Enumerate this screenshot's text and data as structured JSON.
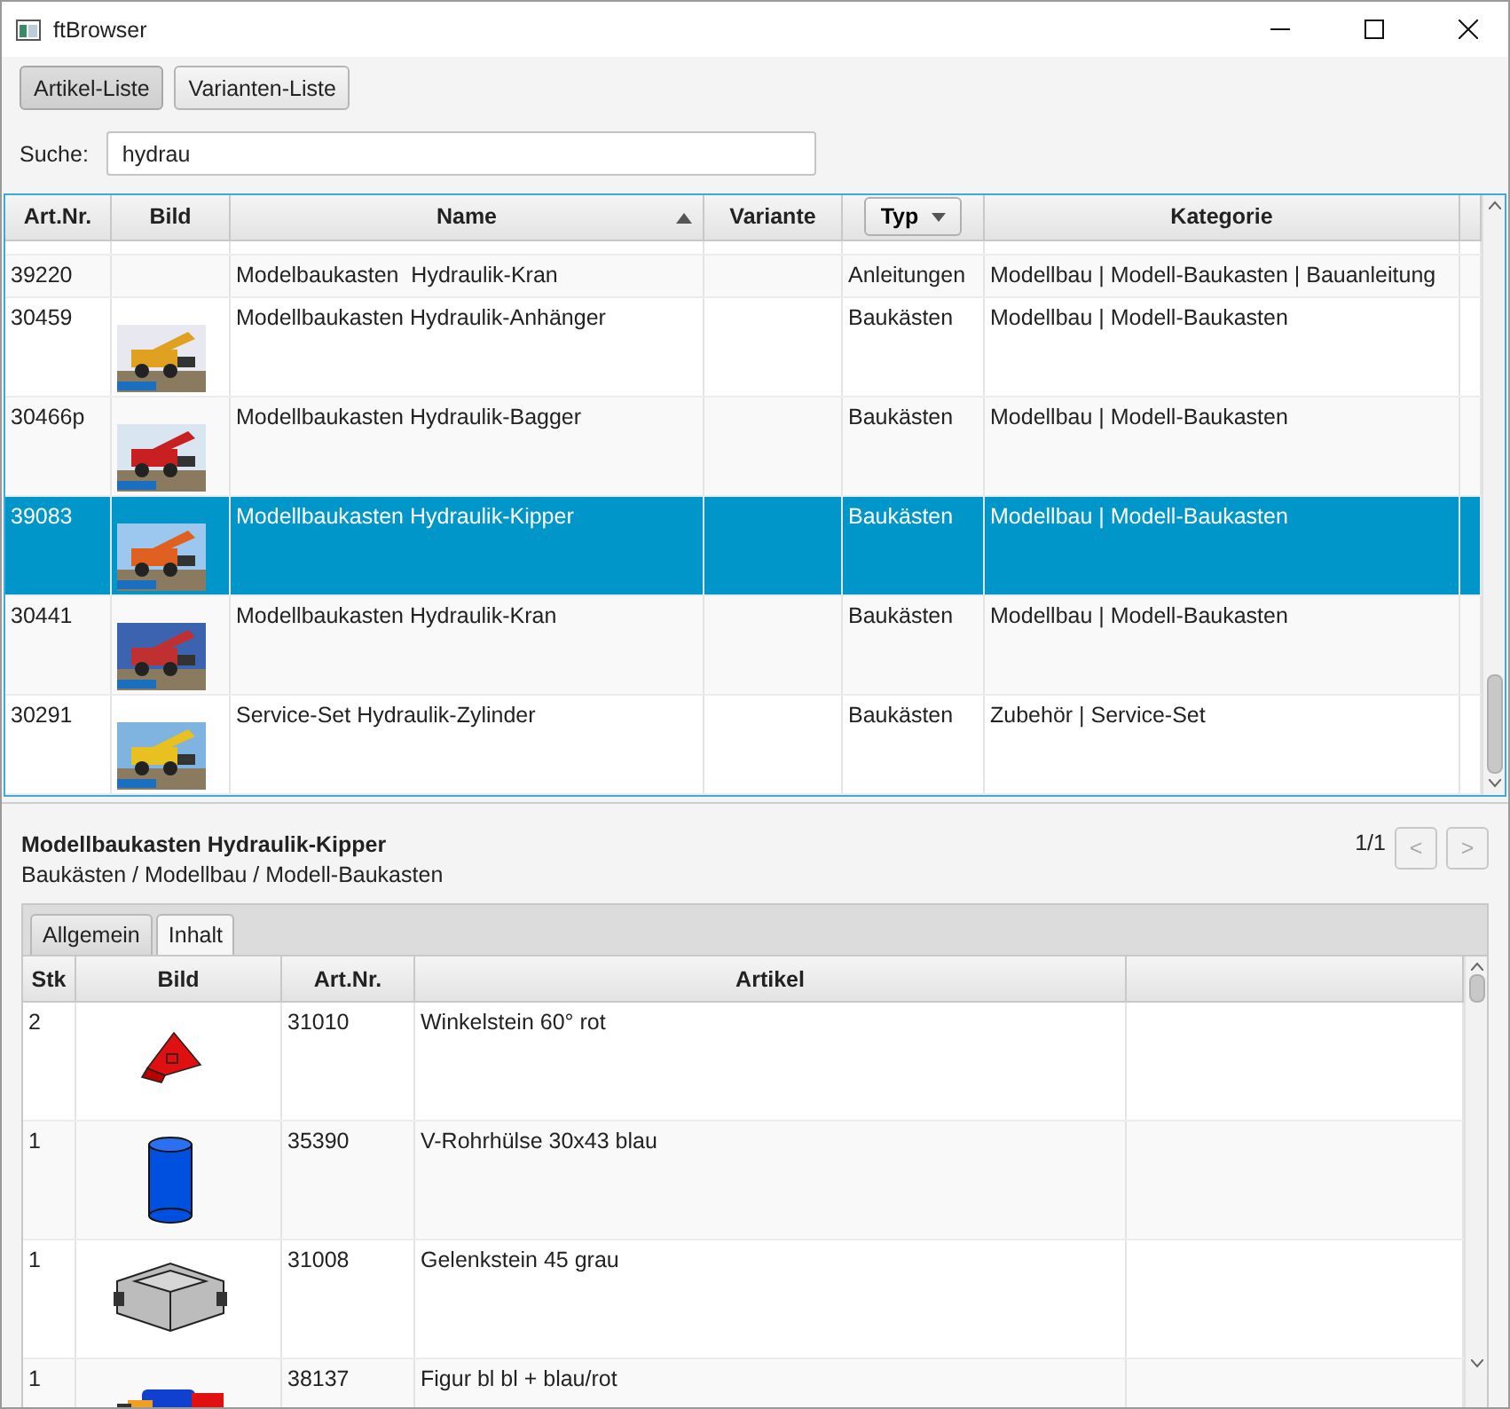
{
  "window": {
    "title": "ftBrowser"
  },
  "view_tabs": [
    {
      "label": "Artikel-Liste",
      "selected": true
    },
    {
      "label": "Varianten-Liste",
      "selected": false
    }
  ],
  "search": {
    "label": "Suche:",
    "value": "hydrau"
  },
  "table": {
    "columns": [
      {
        "label": "Art.Nr."
      },
      {
        "label": "Bild"
      },
      {
        "label": "Name",
        "sorted": true
      },
      {
        "label": "Variante"
      },
      {
        "label": "Typ",
        "filter": true
      },
      {
        "label": "Kategorie"
      }
    ],
    "rows": [
      {
        "art_nr": "39220",
        "name": "Modelbaukasten  Hydraulik-Kran",
        "typ": "Anleitungen",
        "kategorie": "Modellbau | Modell-Baukasten | Bauanleitung",
        "selected": false
      },
      {
        "art_nr": "30459",
        "name": "Modellbaukasten Hydraulik-Anhänger",
        "typ": "Baukästen",
        "kategorie": "Modellbau | Modell-Baukasten",
        "selected": false
      },
      {
        "art_nr": "30466p",
        "name": "Modellbaukasten Hydraulik-Bagger",
        "typ": "Baukästen",
        "kategorie": "Modellbau | Modell-Baukasten",
        "selected": false
      },
      {
        "art_nr": "39083",
        "name": "Modellbaukasten Hydraulik-Kipper",
        "typ": "Baukästen",
        "kategorie": "Modellbau | Modell-Baukasten",
        "selected": true
      },
      {
        "art_nr": "30441",
        "name": "Modellbaukasten Hydraulik-Kran",
        "typ": "Baukästen",
        "kategorie": "Modellbau | Modell-Baukasten",
        "selected": false
      },
      {
        "art_nr": "30291",
        "name": "Service-Set Hydraulik-Zylinder",
        "typ": "Baukästen",
        "kategorie": "Zubehör | Service-Set",
        "selected": false
      }
    ]
  },
  "detail": {
    "title": "Modellbaukasten Hydraulik-Kipper",
    "path": "Baukästen / Modellbau / Modell-Baukasten",
    "pager": {
      "label": "1/1",
      "prev": {
        "label": "<",
        "disabled": true
      },
      "next": {
        "label": ">",
        "disabled": true
      }
    },
    "tabs": [
      {
        "label": "Allgemein",
        "selected": false
      },
      {
        "label": "Inhalt",
        "selected": true
      }
    ],
    "parts": {
      "columns": [
        {
          "label": "Stk"
        },
        {
          "label": "Bild"
        },
        {
          "label": "Art.Nr."
        },
        {
          "label": "Artikel"
        }
      ],
      "rows": [
        {
          "stk": "2",
          "art_nr": "31010",
          "artikel": "Winkelstein 60° rot"
        },
        {
          "stk": "1",
          "art_nr": "35390",
          "artikel": "V-Rohrhülse 30x43 blau"
        },
        {
          "stk": "1",
          "art_nr": "31008",
          "artikel": "Gelenkstein 45 grau"
        },
        {
          "stk": "1",
          "art_nr": "38137",
          "artikel": "Figur bl bl + blau/rot"
        }
      ]
    }
  }
}
